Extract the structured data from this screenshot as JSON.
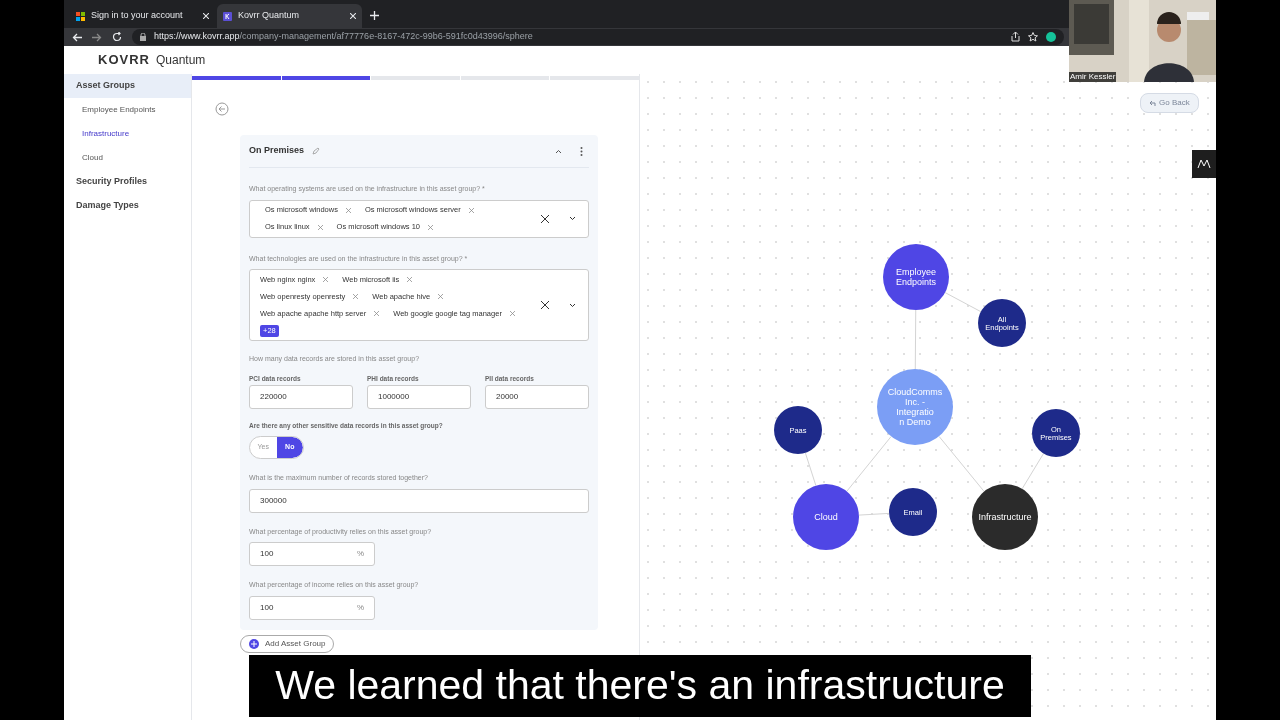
{
  "browser": {
    "tabs": [
      {
        "title": "Sign in to your account",
        "selected": false
      },
      {
        "title": "Kovrr Quantum",
        "selected": true
      }
    ],
    "url_host": "https://www.kovrr.app",
    "url_path": "/company-management/af77776e-8167-472c-99b6-591fc0d43996/sphere"
  },
  "app": {
    "logo": "KOVRR",
    "product": "Quantum"
  },
  "sidebar": [
    {
      "label": "Asset Groups",
      "selected": false,
      "children": [
        {
          "label": "Employee Endpoints",
          "selected": false
        },
        {
          "label": "Infrastructure",
          "selected": true
        },
        {
          "label": "Cloud",
          "selected": false
        }
      ]
    },
    {
      "label": "Security Profiles",
      "selected": false
    },
    {
      "label": "Damage Types",
      "selected": false
    }
  ],
  "progress_steps": [
    {
      "complete": true
    },
    {
      "complete": true
    },
    {
      "complete": false
    },
    {
      "complete": false
    },
    {
      "complete": false
    }
  ],
  "card": {
    "title": "On Premises",
    "os_question": "What operating systems are used on the infrastructure in this asset group? *",
    "os_tags": [
      "Os microsoft windows",
      "Os microsoft windows server",
      "Os linux linux",
      "Os microsoft windows 10"
    ],
    "tech_question": "What technologies are used on the infrastructure in this asset group? *",
    "tech_tags": [
      "Web nginx nginx",
      "Web microsoft iis",
      "Web openresty openresty",
      "Web apache hive",
      "Web apache apache http server",
      "Web google google tag manager"
    ],
    "tech_more": "+28",
    "records_question": "How many data records are stored in this asset group?",
    "records": [
      {
        "label": "PCI data records",
        "value": "220000"
      },
      {
        "label": "PHI data records",
        "value": "1000000"
      },
      {
        "label": "PII data records",
        "value": "20000"
      }
    ],
    "sensitive_question": "Are there any other sensitive data records in this asset group?",
    "sensitive_options": [
      {
        "label": "Yes",
        "selected": false
      },
      {
        "label": "No",
        "selected": true
      }
    ],
    "max_question": "What is the maximum number of records stored together?",
    "max_value": "300000",
    "productivity_question": "What percentage of productivity relies on this asset group?",
    "productivity_value": "100",
    "productivity_unit": "%",
    "income_question": "What percentage of income relies on this asset group?",
    "income_value": "100",
    "income_unit": "%"
  },
  "add_button": "Add Asset Group",
  "go_back": "Go Back",
  "graph": {
    "label": "CloudComms Inc. - Integratio n Demo",
    "color": "#7b9ef5",
    "children": [
      {
        "label": "Employee Endpoints",
        "color": "#4f46e5",
        "children": [
          {
            "label": "All Endpoints",
            "color": "#1e2a8a"
          }
        ]
      },
      {
        "label": "Cloud",
        "color": "#4f46e5",
        "children": [
          {
            "label": "Paas",
            "color": "#1e2a8a"
          },
          {
            "label": "Email",
            "color": "#1e2a8a"
          }
        ]
      },
      {
        "label": "Infrastructure",
        "color": "#2b2b2b",
        "children": [
          {
            "label": "On Premises",
            "color": "#1e2a8a"
          }
        ]
      }
    ]
  },
  "webcam": {
    "name": "Amir Kessler"
  },
  "subtitle": "We learned that there's an infrastructure"
}
